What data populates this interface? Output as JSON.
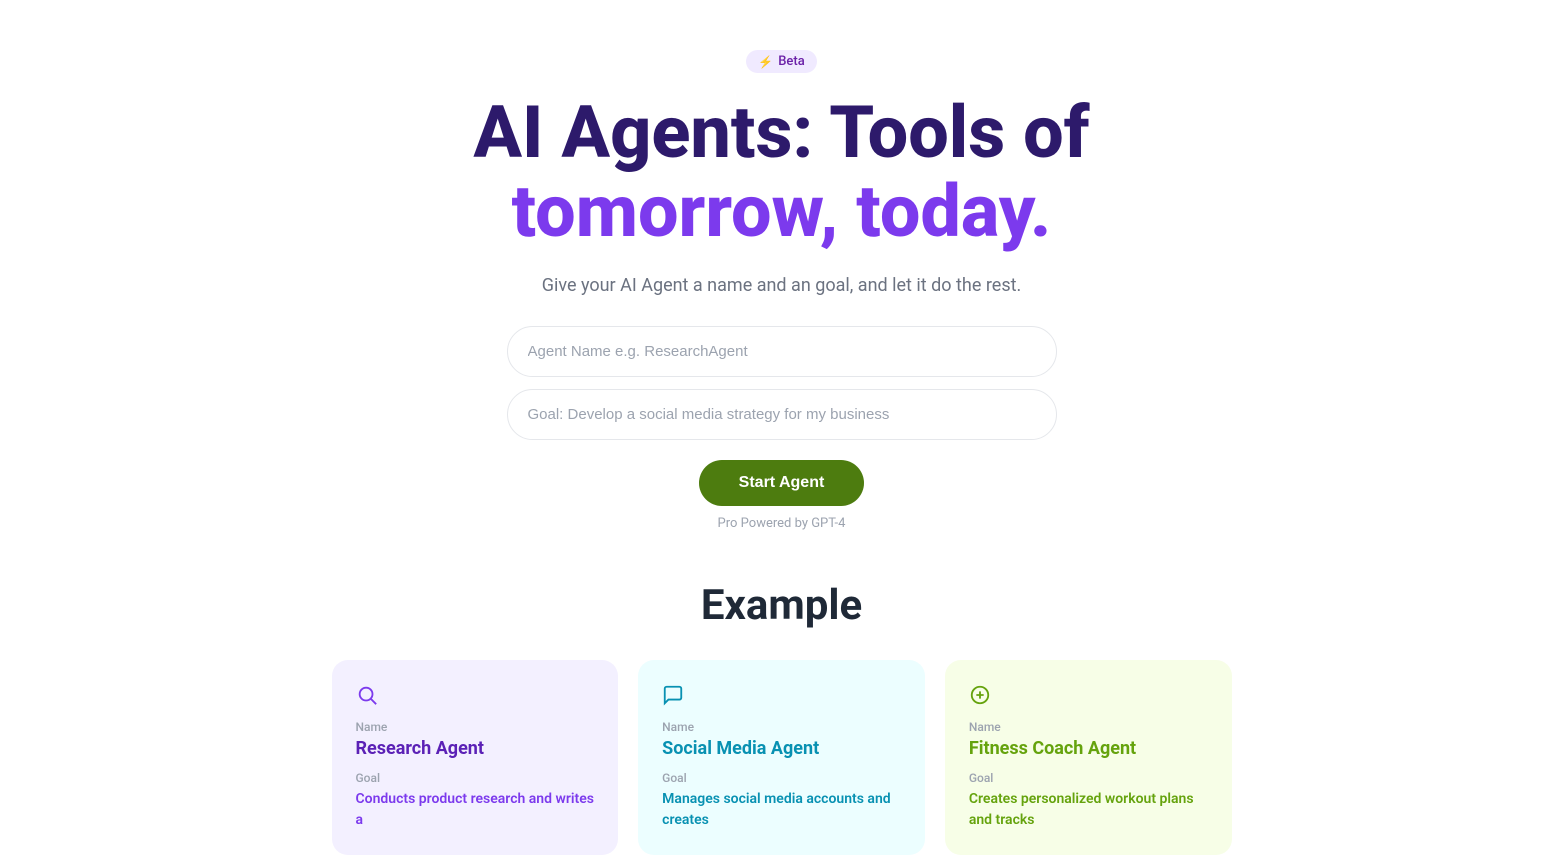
{
  "beta": {
    "label": "Beta",
    "icon": "⚡"
  },
  "hero": {
    "title_line1": "AI Agents: Tools of",
    "title_line2": "tomorrow, today.",
    "subtitle": "Give your AI Agent a name and an goal, and let it do the rest."
  },
  "form": {
    "agent_name_placeholder": "Agent Name e.g. ResearchAgent",
    "goal_placeholder": "Goal: Develop a social media strategy for my business",
    "start_button_label": "Start Agent",
    "powered_by": "Pro Powered by GPT-4"
  },
  "examples": {
    "section_title": "Example",
    "cards": [
      {
        "id": "research",
        "name_label": "Name",
        "name": "Research Agent",
        "goal_label": "Goal",
        "goal": "Conducts product research and writes a",
        "color": "purple"
      },
      {
        "id": "social",
        "name_label": "Name",
        "name": "Social Media Agent",
        "goal_label": "Goal",
        "goal": "Manages social media accounts and creates",
        "color": "cyan"
      },
      {
        "id": "fitness",
        "name_label": "Name",
        "name": "Fitness Coach Agent",
        "goal_label": "Goal",
        "goal": "Creates personalized workout plans and tracks",
        "color": "green"
      }
    ]
  }
}
